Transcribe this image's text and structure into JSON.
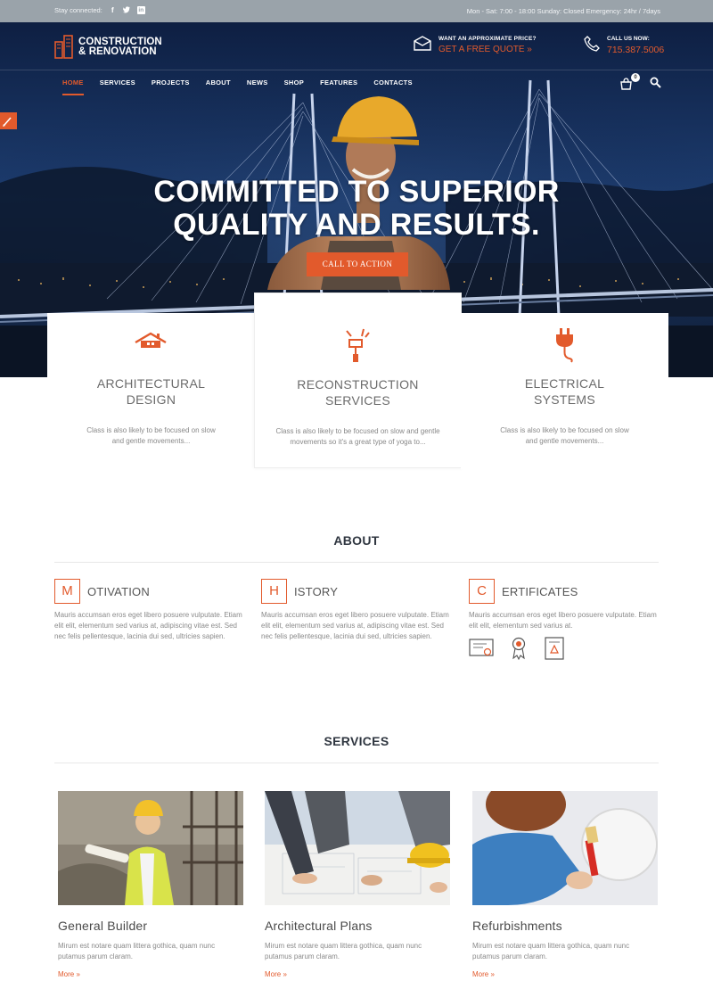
{
  "topbar": {
    "stay_connected": "Stay connected:",
    "hours": "Mon - Sat: 7:00 - 18:00  Sunday: Closed  Emergency: 24hr / 7days"
  },
  "header": {
    "logo_line1": "CONSTRUCTION",
    "logo_line2": "& RENOVATION",
    "quote_small": "WANT AN APPROXIMATE PRICE?",
    "quote_link": "GET A FREE QUOTE »",
    "call_small": "CALL US NOW:",
    "call_number": "715.387.5006"
  },
  "nav": {
    "items": [
      "HOME",
      "SERVICES",
      "PROJECTS",
      "ABOUT",
      "NEWS",
      "SHOP",
      "FEATURES",
      "CONTACTS"
    ],
    "cart_count": "0"
  },
  "hero": {
    "title_line1": "COMMITTED TO SUPERIOR",
    "title_line2": "QUALITY AND RESULTS.",
    "cta": "CALL TO ACTION"
  },
  "features": [
    {
      "title1": "ARCHITECTURAL",
      "title2": "DESIGN",
      "text1": "Class is also likely to be focused on slow",
      "text2": "and gentle movements..."
    },
    {
      "title1": "RECONSTRUCTION",
      "title2": "SERVICES",
      "text1": "Class is also likely to be focused on slow and gentle",
      "text2": "movements so it's a great type of yoga to..."
    },
    {
      "title1": "ELECTRICAL",
      "title2": "SYSTEMS",
      "text1": "Class is also likely to be focused on slow",
      "text2": "and gentle movements..."
    }
  ],
  "about": {
    "title": "ABOUT",
    "cols": [
      {
        "letter": "M",
        "word": "OTIVATION",
        "text": "Mauris accumsan eros eget libero posuere vulputate. Etiam elit elit, elementum sed varius at, adipiscing vitae est. Sed nec felis pellentesque, lacinia dui sed, ultricies sapien."
      },
      {
        "letter": "H",
        "word": "ISTORY",
        "text": "Mauris accumsan eros eget libero posuere vulputate. Etiam elit elit, elementum sed varius at, adipiscing vitae est. Sed nec felis pellentesque, lacinia dui sed, ultricies sapien."
      },
      {
        "letter": "C",
        "word": "ERTIFICATES",
        "text": "Mauris accumsan eros eget libero posuere vulputate. Etiam elit elit, elementum sed varius at."
      }
    ]
  },
  "services": {
    "title": "SERVICES",
    "items": [
      {
        "title": "General Builder",
        "text": "Mirum est notare quam littera gothica, quam nunc putamus parum claram.",
        "more": "More »"
      },
      {
        "title": "Architectural Plans",
        "text": "Mirum est notare quam littera gothica, quam nunc putamus parum claram.",
        "more": "More »"
      },
      {
        "title": "Refurbishments",
        "text": "Mirum est notare quam littera gothica, quam nunc putamus parum claram.",
        "more": "More »"
      }
    ]
  },
  "colors": {
    "accent": "#e25a2c",
    "topbar": "#9aa3aa",
    "hero_dark": "#0f2144"
  },
  "icons": [
    "facebook-icon",
    "twitter-icon",
    "linkedin-icon",
    "envelope-icon",
    "phone-icon",
    "cart-icon",
    "search-icon",
    "brush-icon",
    "house-icon",
    "paint-roller-icon",
    "plug-icon",
    "certificate-icon",
    "award-ribbon-icon",
    "diploma-icon"
  ]
}
